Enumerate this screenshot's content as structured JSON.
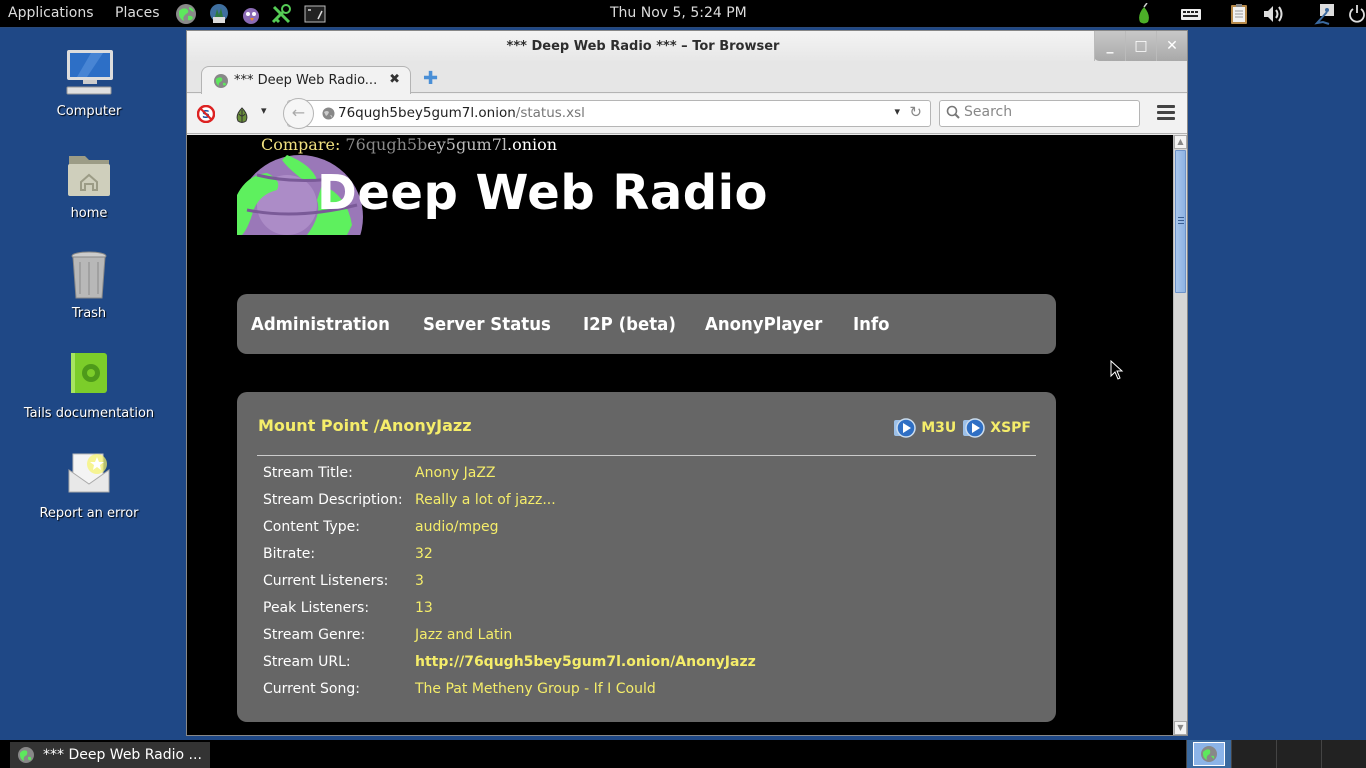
{
  "top_panel": {
    "applications_label": "Applications",
    "places_label": "Places",
    "launchers": [
      "tor-browser-icon",
      "mail-client-icon",
      "pidgin-icon",
      "keepassx-icon",
      "terminal-icon"
    ],
    "clock": "Thu Nov  5,  5:24 PM",
    "tray": [
      "tor-onion-icon",
      "keyboard-icon",
      "clipboard-icon",
      "volume-icon",
      "network-icon",
      "power-icon"
    ]
  },
  "desktop": {
    "icons": [
      {
        "label": "Computer",
        "icon": "computer-icon"
      },
      {
        "label": "home",
        "icon": "home-folder-icon"
      },
      {
        "label": "Trash",
        "icon": "trash-icon"
      },
      {
        "label": "Tails documentation",
        "icon": "documentation-icon"
      },
      {
        "label": "Report an error",
        "icon": "report-error-icon"
      }
    ]
  },
  "browser": {
    "window_title": "*** Deep Web Radio *** – Tor Browser",
    "tab_label": "*** Deep Web Radio...",
    "url_host": "76qugh5bey5gum7l.onion",
    "url_path": "/status.xsl",
    "search_placeholder": "Search"
  },
  "page": {
    "compare_label": "Compare: ",
    "compare_part1": "76qugh5b",
    "compare_part2": "ey5gum7l",
    "compare_part3": ".onion",
    "site_title": "Deep Web Radio",
    "nav": [
      "Administration",
      "Server Status",
      "I2P (beta)",
      "AnonyPlayer",
      "Info"
    ],
    "mount": {
      "title": "Mount Point /AnonyJazz",
      "playlists": [
        "M3U",
        "XSPF"
      ],
      "stats": [
        {
          "key": "Stream Title:",
          "value": "Anony JaZZ"
        },
        {
          "key": "Stream Description:",
          "value": "Really a lot of jazz..."
        },
        {
          "key": "Content Type:",
          "value": "audio/mpeg"
        },
        {
          "key": "Bitrate:",
          "value": "32"
        },
        {
          "key": "Current Listeners:",
          "value": "3"
        },
        {
          "key": "Peak Listeners:",
          "value": "13"
        },
        {
          "key": "Stream Genre:",
          "value": "Jazz and Latin"
        },
        {
          "key": "Stream URL:",
          "value": "http://76qugh5bey5gum7l.onion/AnonyJazz"
        },
        {
          "key": "Current Song:",
          "value": "The Pat Metheny Group - If I Could"
        }
      ]
    }
  },
  "taskbar": {
    "task_label": "*** Deep Web Radio ...",
    "workspaces": 4,
    "active_workspace": 1
  },
  "colors": {
    "desktop_bg": "#1f4886",
    "page_bg": "#000000",
    "panel_gray": "#666666",
    "accent_yellow": "#f5ed6a"
  }
}
